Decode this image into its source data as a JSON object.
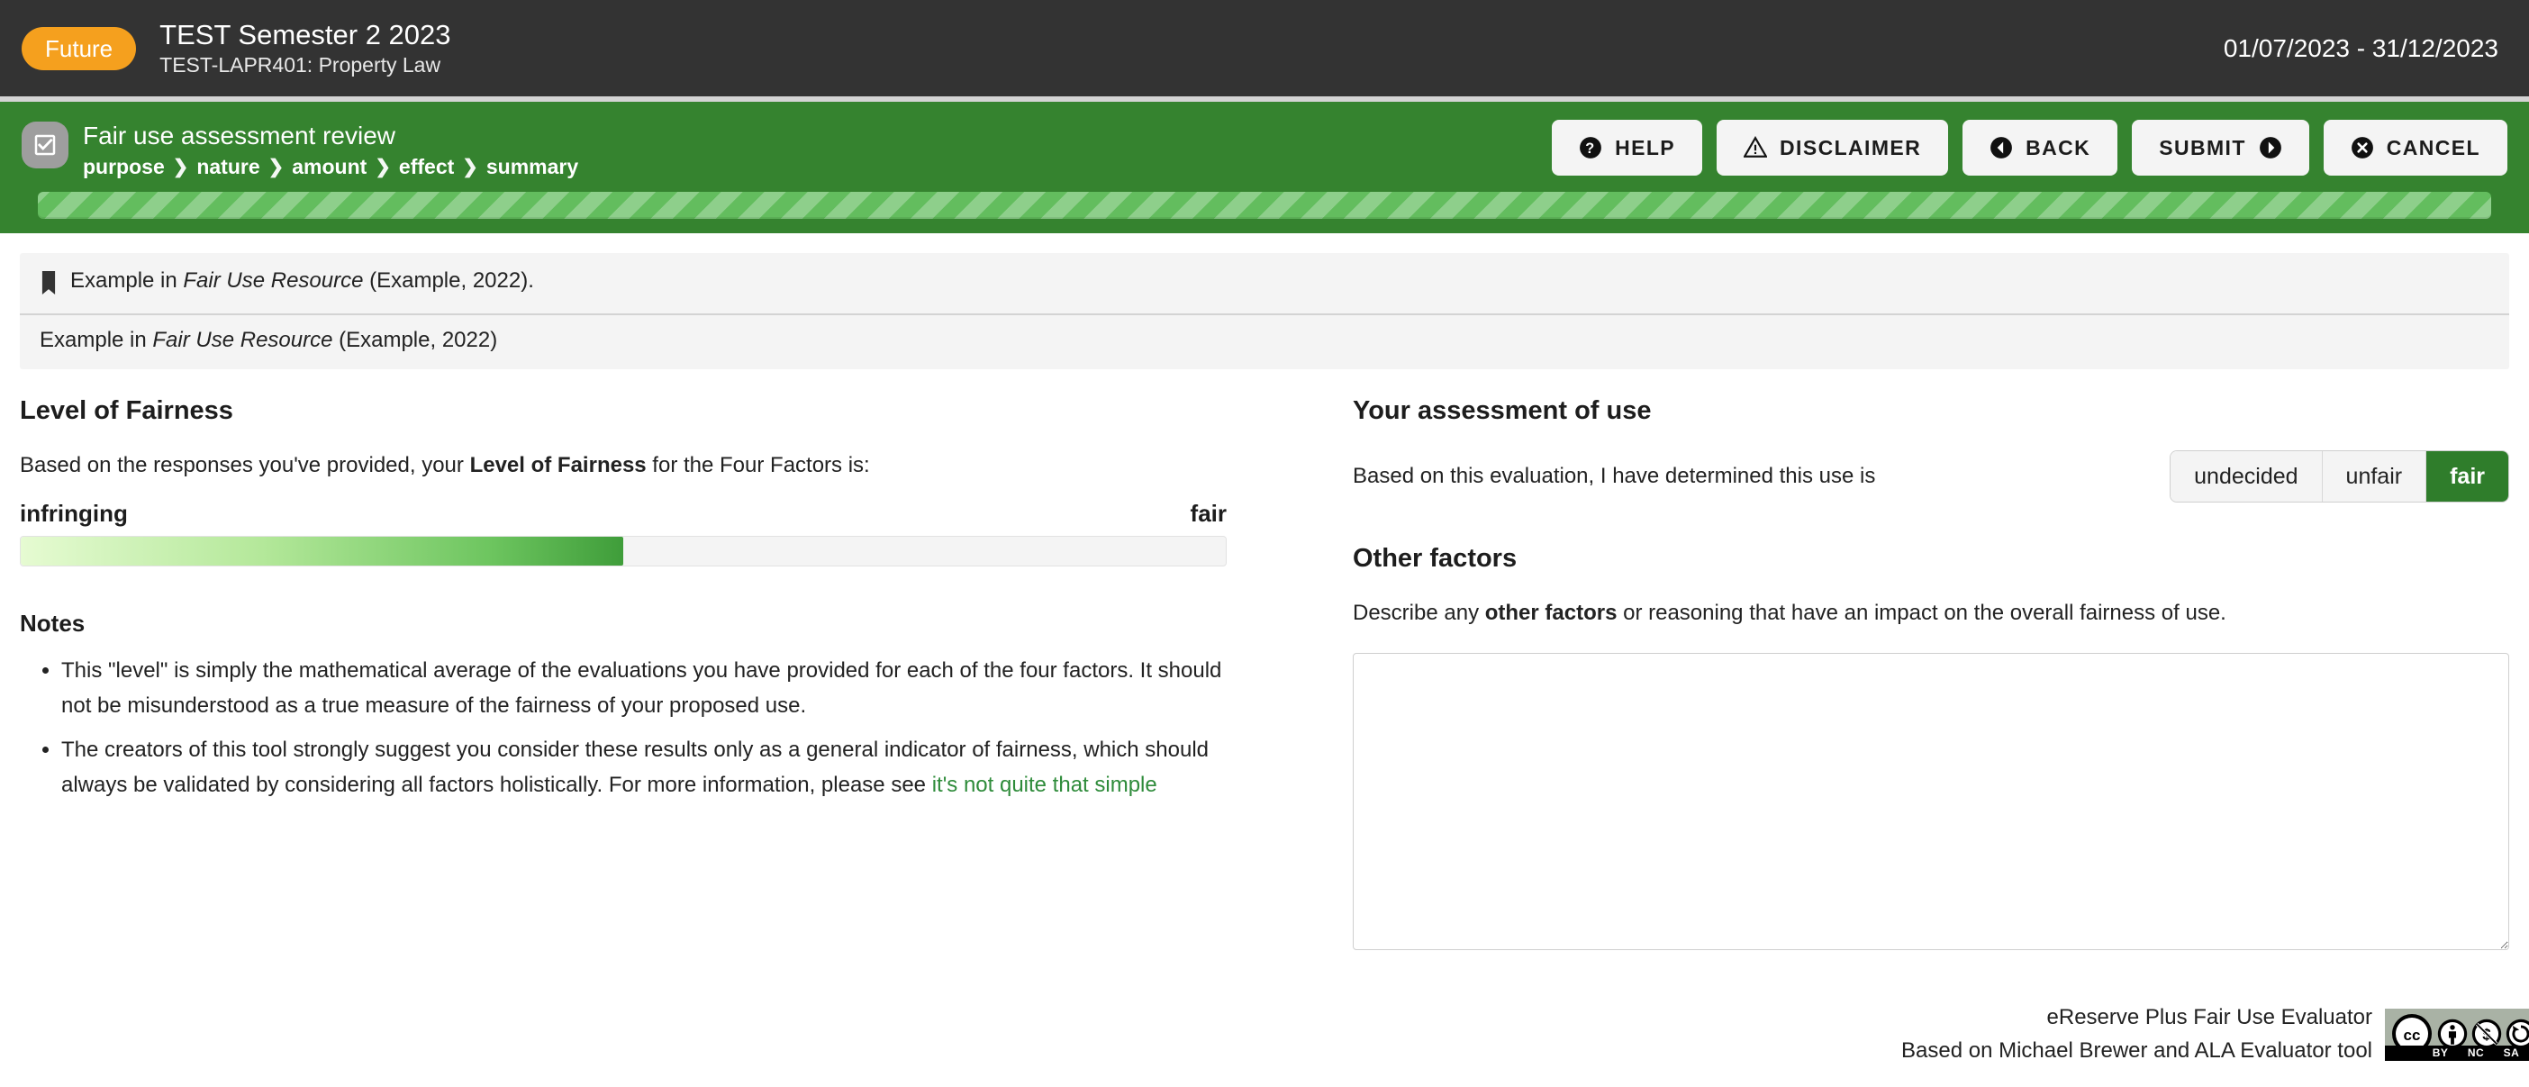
{
  "topbar": {
    "badge": "Future",
    "course_title": "TEST Semester 2 2023",
    "course_code": "TEST-LAPR401: Property Law",
    "date_range": "01/07/2023 - 31/12/2023"
  },
  "header": {
    "icon": "checkbox-check-icon",
    "heading": "Fair use assessment review",
    "breadcrumbs": [
      {
        "label": "purpose"
      },
      {
        "label": "nature"
      },
      {
        "label": "amount"
      },
      {
        "label": "effect"
      },
      {
        "label": "summary"
      }
    ],
    "separator": "❯",
    "buttons": [
      {
        "label": "HELP",
        "icon": "question-circle-icon",
        "icon_position": "left"
      },
      {
        "label": "DISCLAIMER",
        "icon": "warning-triangle-icon",
        "icon_position": "left"
      },
      {
        "label": "BACK",
        "icon": "arrow-left-circle-icon",
        "icon_position": "left"
      },
      {
        "label": "SUBMIT",
        "icon": "arrow-right-circle-icon",
        "icon_position": "right"
      },
      {
        "label": "CANCEL",
        "icon": "close-circle-icon",
        "icon_position": "left"
      }
    ],
    "progress_percent": 100
  },
  "citation": {
    "icon": "bookmark-icon",
    "line1_pre": "Example in ",
    "line1_title": "Fair Use Resource",
    "line1_post": " (Example, 2022).",
    "line2_pre": "Example in ",
    "line2_title": "Fair Use Resource",
    "line2_post": " (Example, 2022)"
  },
  "fairness": {
    "heading": "Level of Fairness",
    "intro_pre": "Based on the responses you've provided, your ",
    "intro_bold": "Level of Fairness",
    "intro_post": " for the Four Factors is:",
    "low_label": "infringing",
    "high_label": "fair",
    "fill_percent": 50,
    "notes_heading": "Notes",
    "notes": [
      "This \"level\" is simply the mathematical average of the evaluations you have provided for each of the four factors. It should not be misunderstood as a true measure of the fairness of your proposed use.",
      "The creators of this tool strongly suggest you consider these results only as a general indicator of fairness, which should always be validated by considering all factors holistically. For more information, please see "
    ],
    "note_link": "it's not quite that simple"
  },
  "assessment": {
    "heading": "Your assessment of use",
    "statement": "Based on this evaluation, I have determined this use is",
    "options": [
      {
        "label": "undecided",
        "selected": false
      },
      {
        "label": "unfair",
        "selected": false
      },
      {
        "label": "fair",
        "selected": true
      }
    ]
  },
  "other_factors": {
    "heading": "Other factors",
    "desc_pre": "Describe any ",
    "desc_bold": "other factors",
    "desc_post": " or reasoning that have an impact on the overall fairness of use.",
    "value": "",
    "placeholder": ""
  },
  "footer": {
    "line1": "eReserve Plus Fair Use Evaluator",
    "line2": "Based on Michael Brewer and ALA Evaluator tool",
    "license_badge": {
      "cc": "cc",
      "terms": [
        "BY",
        "NC",
        "SA"
      ]
    }
  },
  "colors": {
    "brand_green": "#35832f",
    "accent_orange": "#f5a01e",
    "dark_bar": "#333333",
    "link_green": "#2e8b3a",
    "selected_green": "#2f7d2b"
  }
}
